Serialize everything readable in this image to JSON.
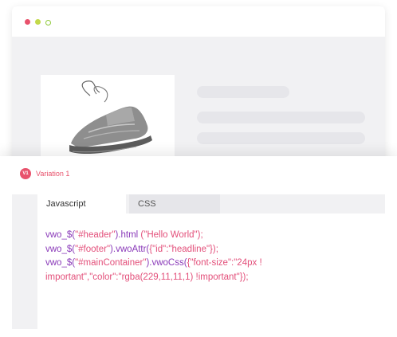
{
  "colors": {
    "accent_red": "#e8526c",
    "dot_yellow": "#c3d94a",
    "dot_green": "#8fc93a",
    "code_purple": "#8a3ab9",
    "code_pink": "#e34f7a",
    "code_dark": "#3a3a3a",
    "skeleton": "#e6e6ea"
  },
  "window_controls": [
    "red-dot",
    "yellow-dot",
    "green-dot"
  ],
  "variation": {
    "badge": "V1",
    "label": "Variation 1"
  },
  "editor": {
    "tabs": [
      {
        "label": "Javascript",
        "active": true,
        "icon": "close-icon"
      },
      {
        "label": "CSS",
        "active": false
      }
    ],
    "code_lines": [
      [
        {
          "t": "vwo_$(",
          "c": "p"
        },
        {
          "t": "\"#header\"",
          "c": "k"
        },
        {
          "t": ").html ",
          "c": "p"
        },
        {
          "t": "(\"Hello World\");",
          "c": "k"
        }
      ],
      [
        {
          "t": "vwo_$(",
          "c": "p"
        },
        {
          "t": "\"#footer\"",
          "c": "k"
        },
        {
          "t": ").vwoAttr(",
          "c": "p"
        },
        {
          "t": "{\"id\":\"headline\"});",
          "c": "k"
        }
      ],
      [
        {
          "t": "vwo_$(",
          "c": "p"
        },
        {
          "t": "\"#mainContainer\"",
          "c": "k"
        },
        {
          "t": ").vwoCss(",
          "c": "p"
        },
        {
          "t": "{\"font-size\":\"24px ! important\",\"color\":\"rgba(229,11,11,1) !important\"});",
          "c": "k"
        }
      ]
    ]
  }
}
